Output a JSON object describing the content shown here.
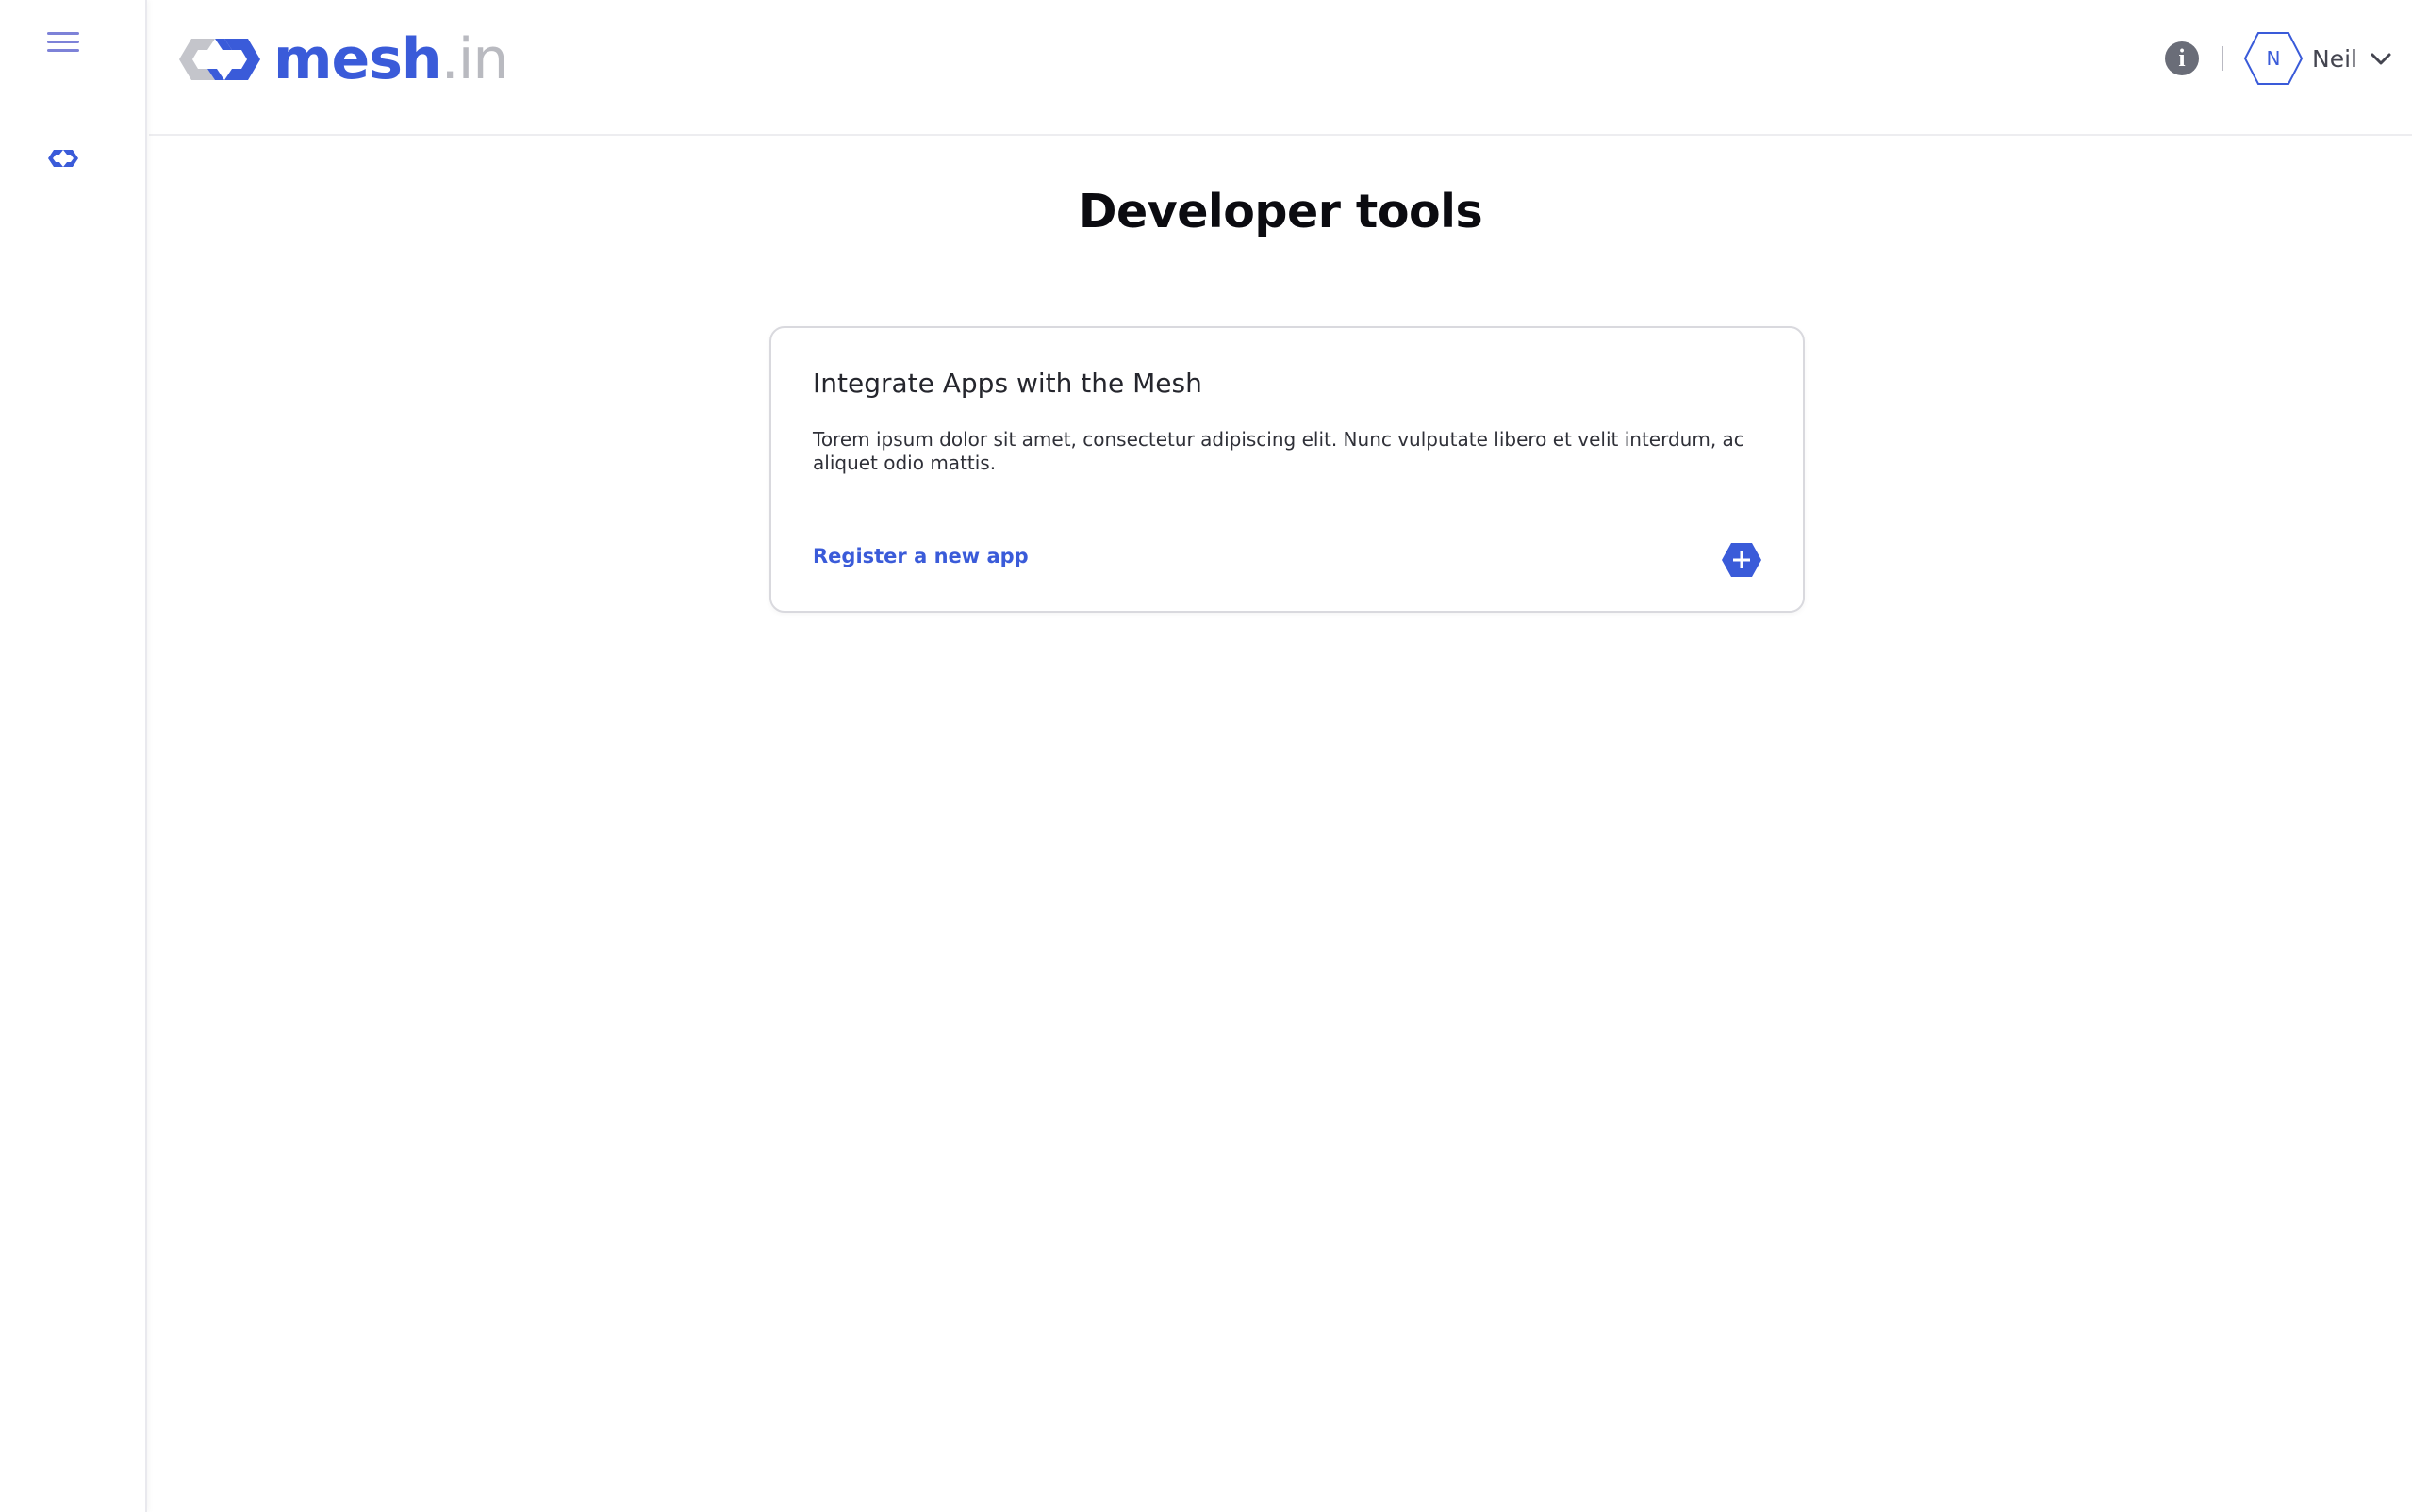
{
  "app": {
    "logo_mesh": "mesh",
    "logo_suffix": ".in"
  },
  "sidebar": {
    "menu_icon": "hamburger-menu-icon",
    "nav_items": [
      {
        "icon": "mesh-link-icon"
      }
    ]
  },
  "header": {
    "info_icon": "info-icon",
    "info_glyph": "i",
    "divider": "|",
    "user": {
      "avatar_letter": "N",
      "name": "Neil",
      "dropdown_icon": "chevron-down-icon"
    }
  },
  "main": {
    "title": "Developer tools",
    "card": {
      "title": "Integrate Apps with the Mesh",
      "description": "Torem ipsum dolor sit amet, consectetur adipiscing elit. Nunc vulputate libero et velit interdum, ac aliquet odio mattis.",
      "link_label": "Register a new app",
      "action_icon": "plus-hexagon-icon"
    }
  },
  "colors": {
    "brand": "#3a5bd9",
    "logo_grey": "#b9bac0",
    "menu_icon": "#7d82d8",
    "info_icon_bg": "#6a6d78",
    "card_border": "#d9d9de"
  }
}
